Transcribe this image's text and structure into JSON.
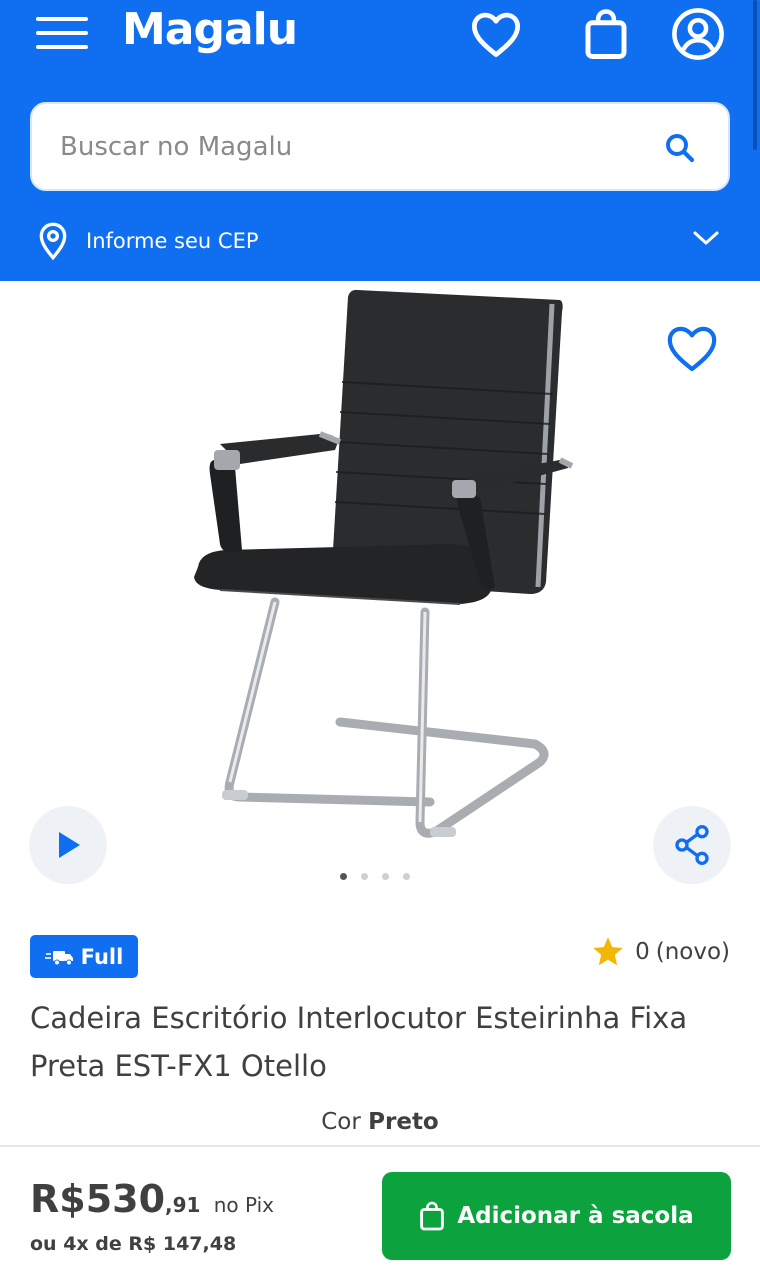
{
  "header": {
    "logo_text": "Magalu",
    "search_placeholder": "Buscar no Magalu",
    "cep_label": "Informe seu CEP",
    "icons": [
      "menu-icon",
      "heart-icon",
      "bag-icon",
      "user-icon",
      "search-icon",
      "location-pin-icon",
      "chevron-down-icon"
    ]
  },
  "gallery": {
    "total_images": 4,
    "active_index": 0,
    "icons": [
      "heart-outline-icon",
      "play-icon",
      "share-icon"
    ]
  },
  "product": {
    "badge_label": "Full",
    "rating_value": "0",
    "rating_label": "(novo)",
    "title": "Cadeira Escritório Interlocutor Esteirinha Fixa Preta EST-FX1 Otello",
    "color_label": "Cor",
    "color_value": "Preto"
  },
  "purchase": {
    "price_main": "R$530",
    "price_cents": ",91",
    "price_suffix": "no Pix",
    "installments": "ou 4x de R$ 147,48",
    "add_button_label": "Adicionar à sacola"
  },
  "colors": {
    "brand_blue": "#0f6ff0",
    "buy_green": "#0ca33e",
    "star_yellow": "#f2b705"
  }
}
